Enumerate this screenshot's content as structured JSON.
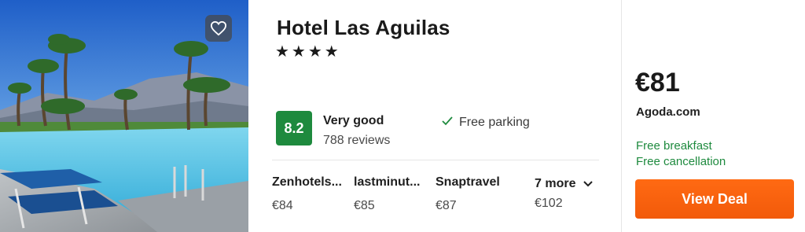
{
  "hotel": {
    "name": "Hotel Las Aguilas",
    "stars": "★★★★",
    "star_count": 4
  },
  "rating": {
    "score": "8.2",
    "label": "Very good",
    "reviews": "788 reviews",
    "color": "#1e8a3e"
  },
  "amenities": [
    {
      "label": "Free parking",
      "icon": "check-icon"
    }
  ],
  "providers": [
    {
      "name": "Zenhotels...",
      "price": "€84"
    },
    {
      "name": "lastminut...",
      "price": "€85"
    },
    {
      "name": "Snaptravel",
      "price": "€87"
    }
  ],
  "more_providers": {
    "label": "7 more",
    "price": "€102",
    "icon": "chevron-down-icon"
  },
  "deal": {
    "price": "€81",
    "site": "Agoda.com",
    "perks": [
      "Free breakfast",
      "Free cancellation"
    ],
    "button_label": "View Deal",
    "button_color": "#f25a0a",
    "perk_color": "#1e8a3e"
  },
  "favorite": {
    "icon": "heart-icon"
  }
}
